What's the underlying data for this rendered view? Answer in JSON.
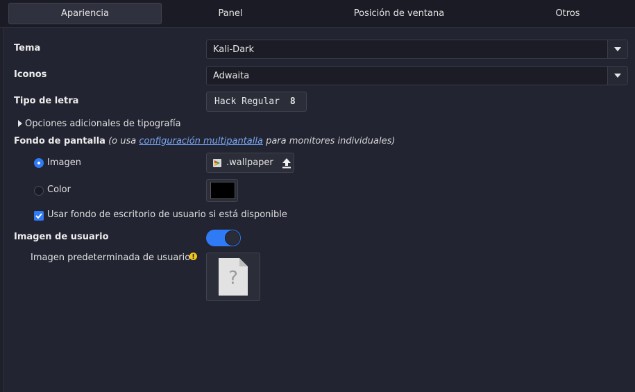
{
  "tabs": [
    {
      "label": "Apariencia",
      "active": true
    },
    {
      "label": "Panel",
      "active": false
    },
    {
      "label": "Posición de ventana",
      "active": false
    },
    {
      "label": "Otros",
      "active": false
    }
  ],
  "tema": {
    "label": "Tema",
    "value": "Kali-Dark"
  },
  "iconos": {
    "label": "Iconos",
    "value": "Adwaita"
  },
  "font": {
    "label": "Tipo de letra",
    "family": "Hack Regular",
    "size": "8"
  },
  "font_options": {
    "label": "Opciones adicionales de tipografía"
  },
  "wallpaper": {
    "label": "Fondo de pantalla",
    "note_prefix": "(o usa",
    "note_link": "configuración multipantalla",
    "note_suffix": "para monitores individuales)",
    "radio_image": "Imagen",
    "radio_color": "Color",
    "selected": "Imagen",
    "file_name": ".wallpaper",
    "color_value": "#000000",
    "user_bg_label": "Usar fondo de escritorio de usuario si está disponible",
    "user_bg_checked": true
  },
  "user_image": {
    "label": "Imagen de usuario",
    "enabled": true,
    "default_label": "Imagen predeterminada de usuario",
    "placeholder_glyph": "?"
  },
  "colors": {
    "accent": "#2f7bf5",
    "warning": "#f5c518",
    "background": "#222431"
  }
}
